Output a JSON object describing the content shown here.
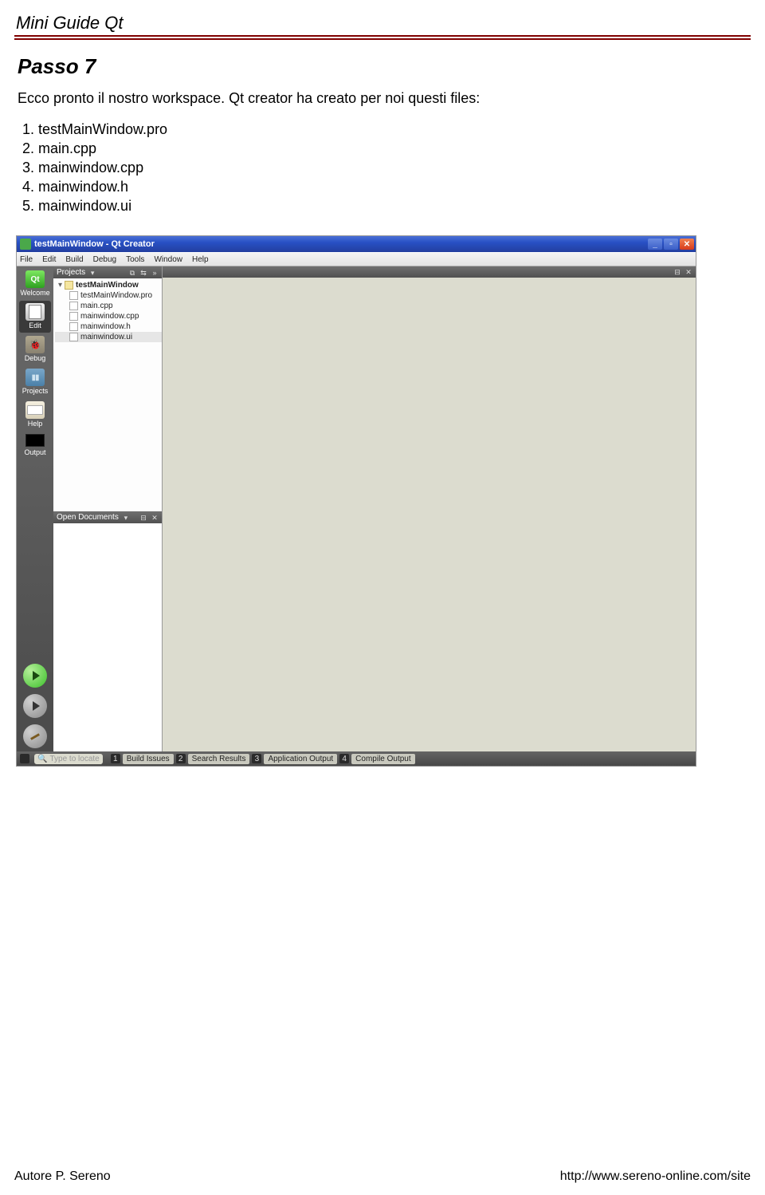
{
  "doc": {
    "title": "Mini Guide Qt",
    "section": "Passo 7",
    "intro": "Ecco pronto il nostro workspace. Qt creator ha creato per noi questi files:",
    "files": [
      "testMainWindow.pro",
      "main.cpp",
      "mainwindow.cpp",
      "mainwindow.h",
      "mainwindow.ui"
    ]
  },
  "shot": {
    "title": "testMainWindow - Qt Creator",
    "menus": [
      "File",
      "Edit",
      "Build",
      "Debug",
      "Tools",
      "Window",
      "Help"
    ],
    "modes": {
      "welcome": "Welcome",
      "edit": "Edit",
      "debug": "Debug",
      "projects": "Projects",
      "help": "Help",
      "output": "Output"
    },
    "projects_hdr": "Projects",
    "opendocs_hdr": "Open Documents",
    "tree": {
      "root": "testMainWindow",
      "items": [
        "testMainWindow.pro",
        "main.cpp",
        "mainwindow.cpp",
        "mainwindow.h",
        "mainwindow.ui"
      ]
    },
    "locator_placeholder": "Type to locate",
    "bottom": {
      "t1": "Build Issues",
      "t2": "Search Results",
      "t3": "Application Output",
      "t4": "Compile Output"
    }
  },
  "footer": {
    "author": "Autore P. Sereno",
    "url": "http://www.sereno-online.com/site"
  }
}
